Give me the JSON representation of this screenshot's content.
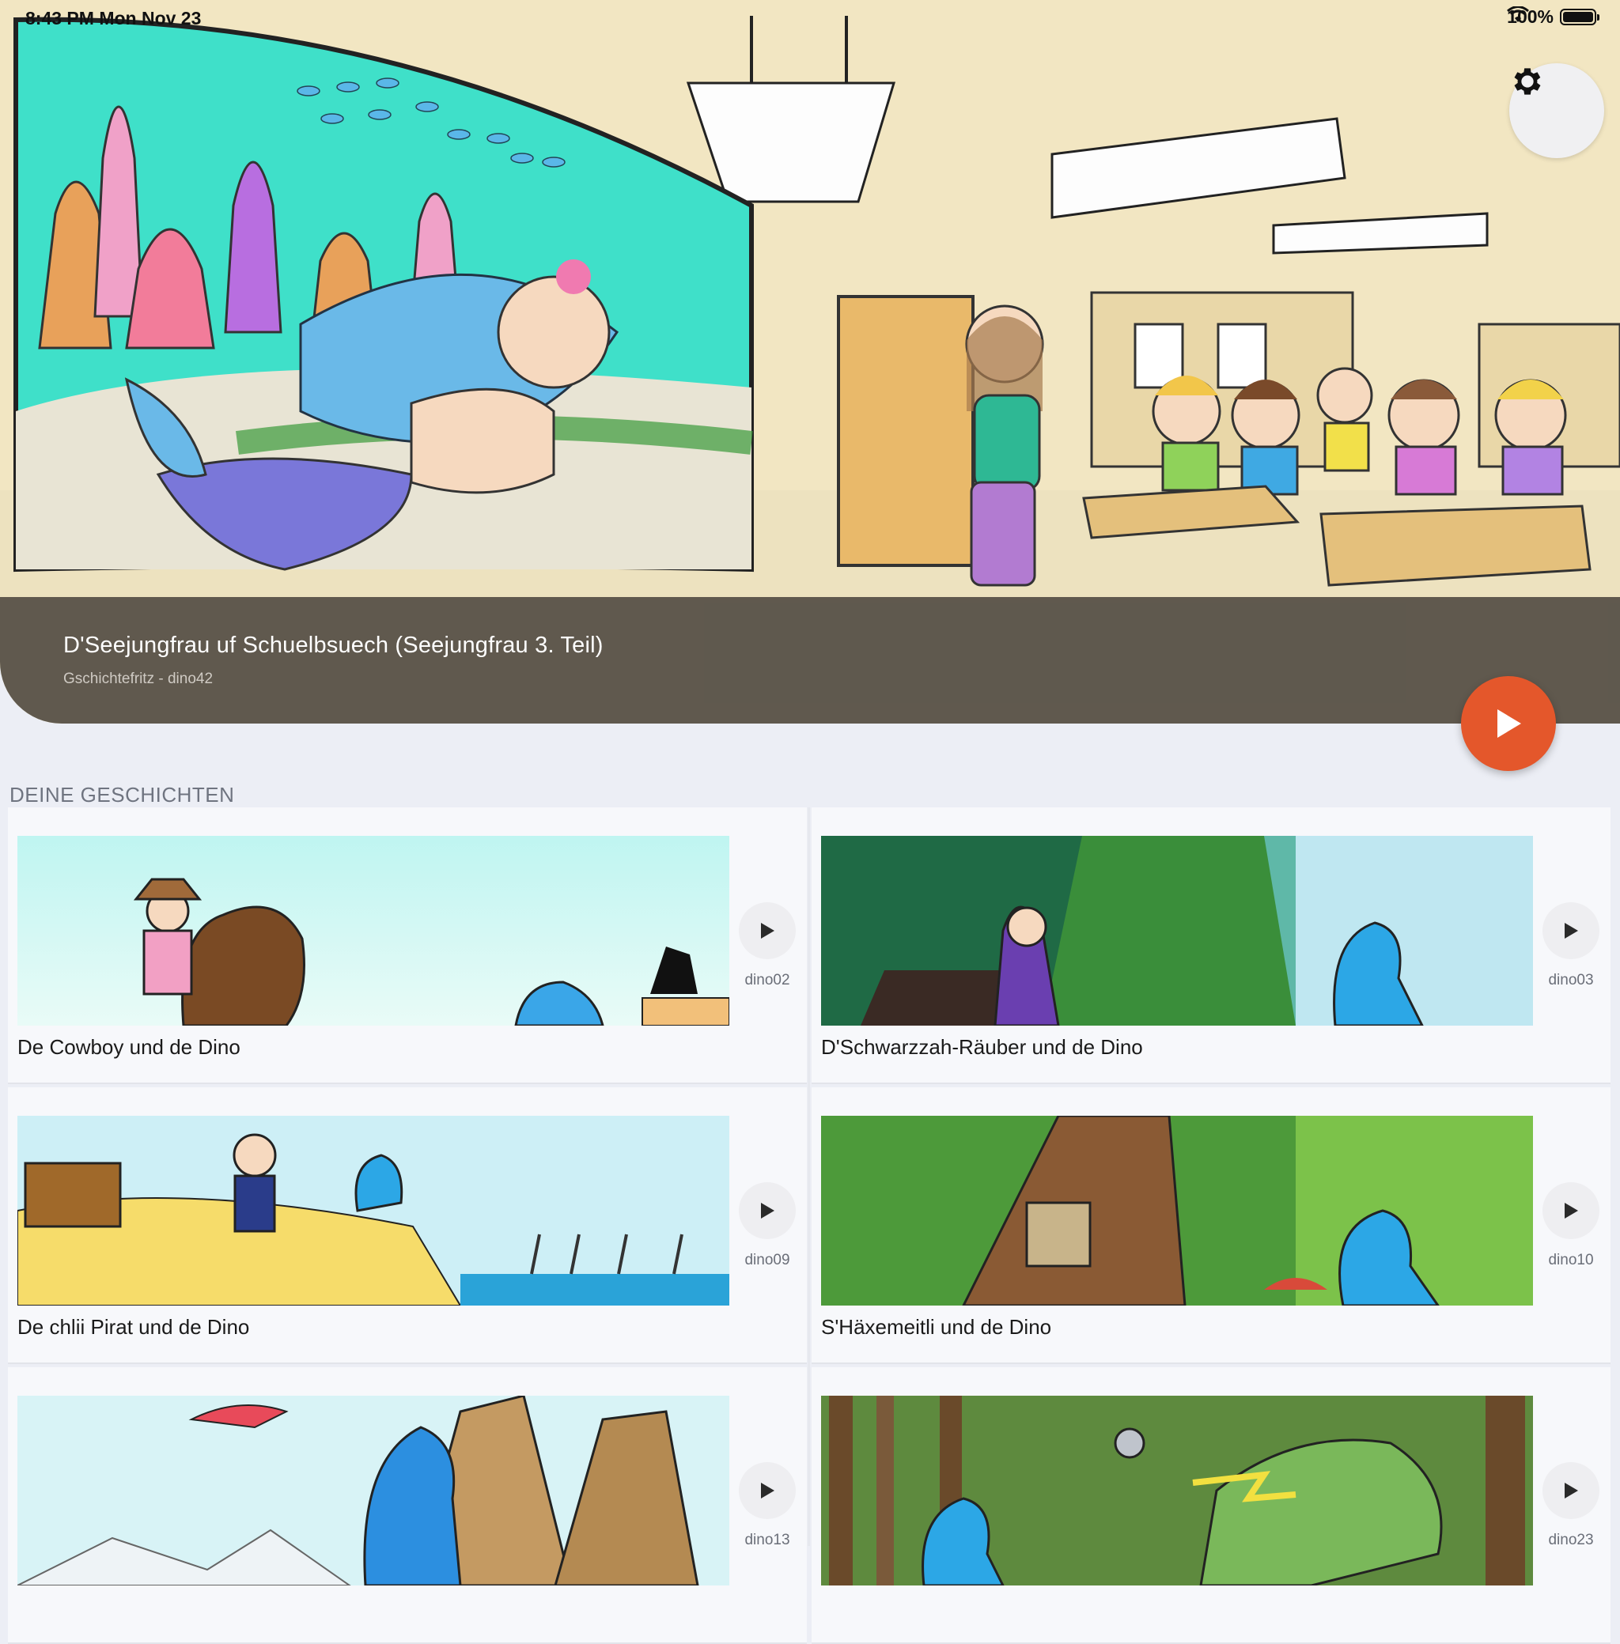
{
  "status_bar": {
    "time": "8:43 PM   Mon Nov 23",
    "battery": "100%"
  },
  "hero": {
    "title": "D'Seejungfrau uf Schuelbsuech (Seejungfrau 3. Teil)",
    "subtitle": "Gschichtefritz - dino42",
    "settings_icon": "gear-icon",
    "play_icon": "play-icon",
    "accent": "#e4572b"
  },
  "section": {
    "title": "DEINE GESCHICHTEN"
  },
  "stories": [
    {
      "title": "De Cowboy und de Dino",
      "code": "dino02"
    },
    {
      "title": "D'Schwarzzah-Räuber und de Dino",
      "code": "dino03"
    },
    {
      "title": "De chlii Pirat und de Dino",
      "code": "dino09"
    },
    {
      "title": "S'Häxemeitli und de Dino",
      "code": "dino10"
    },
    {
      "title": "",
      "code": "dino13"
    },
    {
      "title": "",
      "code": "dino23"
    }
  ]
}
